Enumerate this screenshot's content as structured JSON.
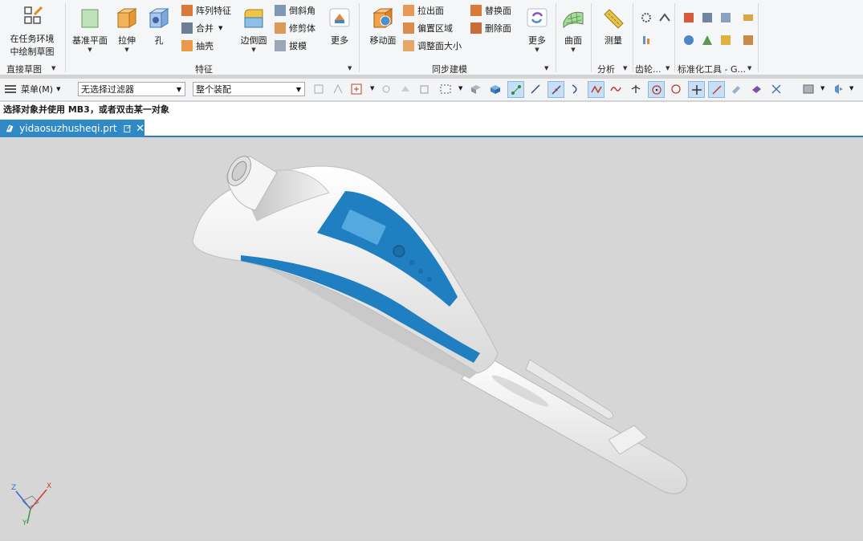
{
  "ribbon": {
    "direct_sketch": {
      "line1": "在任务环境",
      "line2": "中绘制草图",
      "group": "直接草图"
    },
    "feature": {
      "group": "特征",
      "datum_plane": "基准平面",
      "extrude": "拉伸",
      "hole": "孔",
      "pattern_feature": "阵列特征",
      "unite": "合并",
      "shell": "抽壳",
      "edge_blend": "边倒圆",
      "chamfer": "倒斜角",
      "trim_body": "修剪体",
      "draft": "拔模",
      "more": "更多"
    },
    "sync": {
      "group": "同步建模",
      "move_face": "移动面",
      "pull_face": "拉出面",
      "offset_region": "偏置区域",
      "resize_face": "调整面大小",
      "replace_face": "替换面",
      "delete_face": "删除面",
      "more": "更多"
    },
    "surface": {
      "label": "曲面"
    },
    "analysis": {
      "measure": "测量",
      "group": "分析"
    },
    "gear": {
      "group": "齿轮..."
    },
    "std_tools": {
      "group": "标准化工具 - G..."
    }
  },
  "toolbar": {
    "menu": "菜单(M)",
    "filter": "无选择过滤器",
    "assembly": "整个装配"
  },
  "status": {
    "prompt": "选择对象并使用 MB3，或者双击某一对象"
  },
  "tabs": [
    {
      "label": "yidaosuzhusheqi.prt"
    }
  ],
  "triad": {
    "x": "X",
    "y": "Y",
    "z": "Z"
  },
  "colors": {
    "accent": "#2f89c5",
    "model_blue": "#1f7fc1",
    "viewport": "#d6d6d6"
  }
}
